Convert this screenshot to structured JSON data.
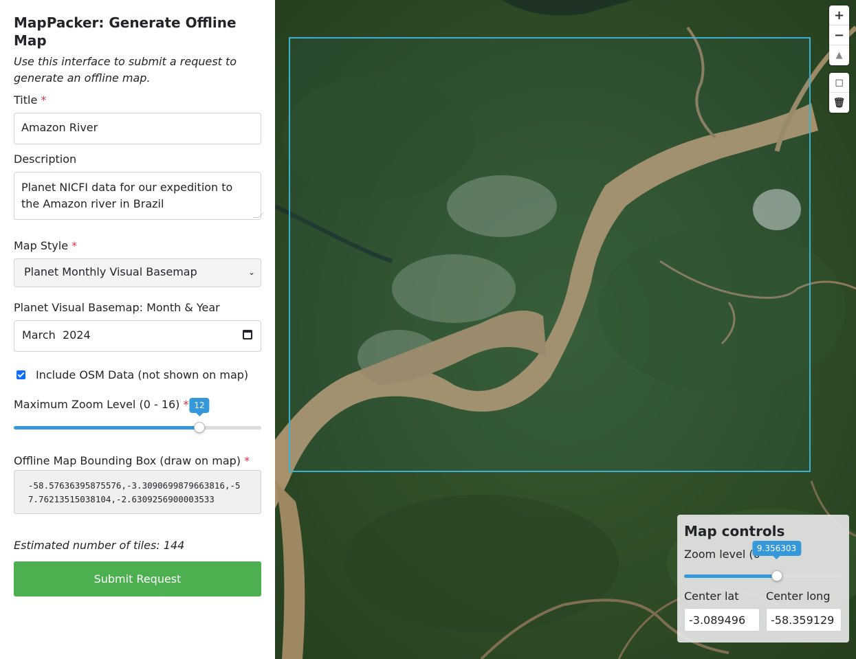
{
  "sidebar": {
    "title": "MapPacker: Generate Offline Map",
    "subtitle": "Use this interface to submit a request to generate an offline map.",
    "fields": {
      "title_label": "Title",
      "title_value": "Amazon River",
      "description_label": "Description",
      "description_value": "Planet NICFI data for our expedition to the Amazon river in Brazil",
      "map_style_label": "Map Style",
      "map_style_value": "Planet Monthly Visual Basemap",
      "basemap_date_label": "Planet Visual Basemap: Month & Year",
      "basemap_date_value": "March  2024",
      "osm_checkbox_label": "Include OSM Data (not shown on map)",
      "osm_checked": true,
      "max_zoom_label": "Maximum Zoom Level (0 - 16)",
      "max_zoom_value": "12",
      "max_zoom_fraction": 0.75,
      "bbox_label": "Offline Map Bounding Box (draw on map)",
      "bbox_value": "-58.57636395875576,-3.3090699879663816,-57.76213515038104,-2.6309256900003533"
    },
    "required_marker": "*",
    "estimate_text": "Estimated number of tiles: 144",
    "submit_label": "Submit Request"
  },
  "map": {
    "zoom_in_icon": "plus-icon",
    "zoom_out_icon": "minus-icon",
    "compass_icon": "compass-icon",
    "draw_polygon_icon": "draw-rectangle-icon",
    "trash_icon": "trash-icon",
    "controls": {
      "title": "Map controls",
      "zoom_label": "Zoom level (0",
      "zoom_value": "9.356303",
      "zoom_fraction": 0.585,
      "center_lat_label": "Center lat",
      "center_lat_value": "-3.089496",
      "center_long_label": "Center long",
      "center_long_value": "-58.359129"
    }
  },
  "colors": {
    "accent": "#3498db",
    "submit": "#4caf50",
    "bbox": "#3bb2d0",
    "required": "#dc3545"
  }
}
